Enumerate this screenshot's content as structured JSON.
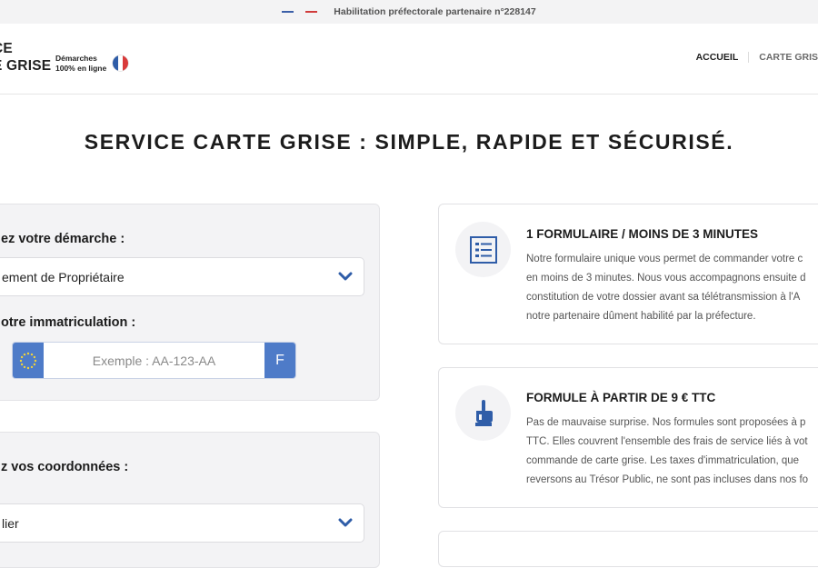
{
  "topbar": {
    "text": "Habilitation préfectorale partenaire n°228147"
  },
  "header": {
    "logo_line1": "CE",
    "logo_line2": "E GRISE",
    "logo_sub1": "Démarches",
    "logo_sub2": "100% en ligne",
    "nav": [
      "ACCUEIL",
      "CARTE GRIS"
    ]
  },
  "page_title": "SERVICE CARTE GRISE : SIMPLE, RAPIDE ET SÉCURISÉ.",
  "form1": {
    "demarche_label": "ez votre démarche :",
    "demarche_value": "ement de Propriétaire",
    "immat_label": "otre immatriculation :",
    "immat_placeholder": "Exemple : AA-123-AA",
    "immat_suffix": "F"
  },
  "form2": {
    "coord_label": "z vos coordonnées :",
    "coord_value": "lier"
  },
  "cards": [
    {
      "icon": "form-list-icon",
      "title": "1 FORMULAIRE / MOINS DE 3 MINUTES",
      "lines": [
        "Notre formulaire unique vous permet de commander votre c",
        "en moins de 3 minutes. Nous vous accompagnons ensuite d",
        "constitution de votre dossier avant sa télétransmission à l'A",
        "notre partenaire dûment habilité par la préfecture."
      ]
    },
    {
      "icon": "hand-ok-icon",
      "title": "FORMULE À PARTIR DE 9 € TTC",
      "lines": [
        "Pas de mauvaise surprise. Nos formules sont proposées à p",
        "TTC. Elles couvrent l'ensemble des frais de service liés à vot",
        "commande de carte grise. Les taxes d'immatriculation, que",
        "reversons au Trésor Public, ne sont pas incluses dans nos fo"
      ]
    }
  ],
  "colors": {
    "accent": "#2f5da8",
    "plate_blue": "#4e7bc8",
    "panel_bg": "#f3f3f5"
  }
}
